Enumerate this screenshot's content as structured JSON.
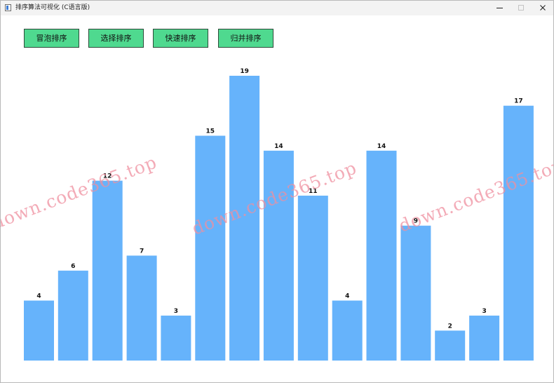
{
  "window": {
    "title": "排序算法可视化 (C语言版)",
    "icon": "app-window-icon",
    "controls": [
      "minimize-icon",
      "maximize-icon",
      "close-icon"
    ]
  },
  "toolbar": {
    "bubble_label": "冒泡排序",
    "select_label": "选择排序",
    "quick_label": "快速排序",
    "merge_label": "归并排序"
  },
  "watermark": {
    "text": "down.code365.top"
  },
  "colors": {
    "button_fill": "#4fd98f",
    "bar_fill": "#66b3fb",
    "watermark": "#ef8f9f"
  },
  "chart_data": {
    "type": "bar",
    "categories": [],
    "values": [
      4,
      6,
      12,
      7,
      3,
      15,
      19,
      14,
      11,
      4,
      14,
      9,
      2,
      3,
      17
    ],
    "ylim": [
      0,
      19
    ],
    "grid": false,
    "legend": "none",
    "data_labels": true
  }
}
